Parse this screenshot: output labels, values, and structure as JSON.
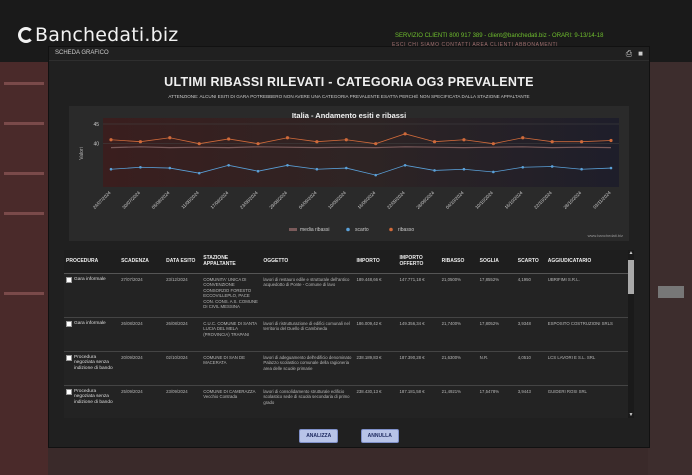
{
  "site": {
    "logo_text": "Banchedati.biz",
    "service_line": "SERVIZIO CLIENTI 800 917 389 - client@banchedati.biz - ORARI: 9-13/14-18",
    "top_links": "ESCI   CHI SIAMO   CONTATTI   AREA CLIENTI   ABBONAMENTI"
  },
  "modal": {
    "header_label": "SCHEDA GRAFICO",
    "title": "ULTIMI RIBASSI RILEVATI - CATEGORIA OG3 PREVALENTE",
    "warning": "ATTENZIONE: ALCUNI ESITI DI GARA POTREBBERO NON AVERE UNA CATEGORIA PREVALENTE ESATTA PERCHÉ NON SPECIFICATA DALLA STAZIONE APPALTANTE",
    "credit": "www.banchedati.biz",
    "buttons": {
      "analyze": "ANALIZZA",
      "cancel": "ANNULLA"
    }
  },
  "chart_data": {
    "type": "line",
    "title": "Italia - Andamento esiti e ribassi",
    "ylabel": "Valori",
    "ylim": [
      30,
      45
    ],
    "yticks": [
      40,
      45
    ],
    "categories": [
      "24/07/2024",
      "30/07/2024",
      "05/08/2024",
      "11/08/2024",
      "17/08/2024",
      "23/08/2024",
      "29/08/2024",
      "04/09/2024",
      "10/09/2024",
      "16/09/2024",
      "22/09/2024",
      "28/09/2024",
      "04/10/2024",
      "10/10/2024",
      "16/10/2024",
      "22/10/2024",
      "28/10/2024",
      "03/11/2024"
    ],
    "series": [
      {
        "name": "media ribassi",
        "color": "#7a5a5a",
        "values": [
          39.0,
          39.2,
          39.0,
          39.1,
          39.0,
          39.2,
          39.1,
          39.0,
          39.1,
          39.0,
          39.2,
          39.1,
          39.0,
          39.1,
          39.2,
          39.0,
          39.1,
          39.0
        ]
      },
      {
        "name": "scarto",
        "color": "#5aa0d8",
        "values": [
          33.5,
          34.0,
          33.8,
          32.5,
          34.5,
          33.0,
          34.5,
          33.5,
          33.8,
          32.0,
          34.5,
          33.2,
          33.5,
          32.8,
          34.0,
          34.2,
          33.5,
          33.8
        ]
      },
      {
        "name": "ribasso",
        "color": "#d06a3a",
        "values": [
          41.0,
          40.5,
          41.5,
          40.0,
          41.2,
          40.0,
          41.5,
          40.5,
          41.0,
          40.0,
          42.5,
          40.5,
          41.0,
          40.0,
          41.5,
          40.5,
          40.5,
          40.8
        ]
      }
    ],
    "legend_position": "bottom"
  },
  "table": {
    "headers": [
      "PROCEDURA",
      "SCADENZA",
      "DATA ESITO",
      "STAZIONE APPALTANTE",
      "OGGETTO",
      "IMPORTO",
      "IMPORTO OFFERTO",
      "RIBASSO",
      "SOGLIA",
      "SCARTO",
      "AGGIUDICATARIO"
    ],
    "rows": [
      {
        "procedura": "Gara informale",
        "scadenza": "27/07/2024",
        "data": "23/12/2024",
        "stazione": "COMUNITA' UNICA DI CONVENZIONE CONSORZIO FORESTO ECCOVILLEPLO, PACE CON. CONS. A S. COMUNE DI CIVIL MESSINA",
        "oggetto": "lavori di restauro edile e strutturale dell'antico acquedotto di Ponte - Comune di lavo",
        "importo": "189.448,66 €",
        "offerto": "147.771,18 €",
        "ribasso": "21,0500%",
        "soglia": "17,8552%",
        "scarto": "4,1950",
        "aggiudicatario": "UBRIFIMI S.R.L."
      },
      {
        "procedura": "Gara informale",
        "scadenza": "26/08/2024",
        "data": "26/08/2024",
        "stazione": "C.U.C. COMUNE DI SANTA LUCIA DEL MELA (PROVINCIA) TRAPANI",
        "oggetto": "lavori di ristrutturazione di edifici comunali nel territorio del Duello di Cambineda",
        "importo": "186.009,42 €",
        "offerto": "149.356,34 €",
        "ribasso": "21,7400%",
        "soglia": "17,8052%",
        "scarto": "3,9348",
        "aggiudicatario": "ESPOSITO COSTRUZIONI SRLS"
      },
      {
        "procedura": "Procedura negoziata senza indizione di bando",
        "scadenza": "20/09/2024",
        "data": "02/10/2024",
        "stazione": "COMUNE DI SAN DE MACERATA",
        "oggetto": "lavori di adeguamento dell'edificio denominato Palazzo scolastico comunale della ragioneria area delle scuole primarie",
        "importo": "238.189,83 €",
        "offerto": "187.390,28 €",
        "ribasso": "21,6300%",
        "soglia": "N.R.",
        "scarto": "4,0510",
        "aggiudicatario": "LCS LAVORI E S.L. SRL"
      },
      {
        "procedura": "Procedura negoziata senza indizione di bando",
        "scadenza": "25/09/2024",
        "data": "23/09/2024",
        "stazione": "COMUNE DI CAMERAZZA Vecchio Contrada",
        "oggetto": "lavori di consolidamento strutturale edificio scolastico sede di scuola secondaria di primo grado",
        "importo": "238.430,13 €",
        "offerto": "187.181,58 €",
        "ribasso": "21,4921%",
        "soglia": "17,5478%",
        "scarto": "3,9443",
        "aggiudicatario": "GUIDERI ROSI SRL"
      }
    ]
  }
}
